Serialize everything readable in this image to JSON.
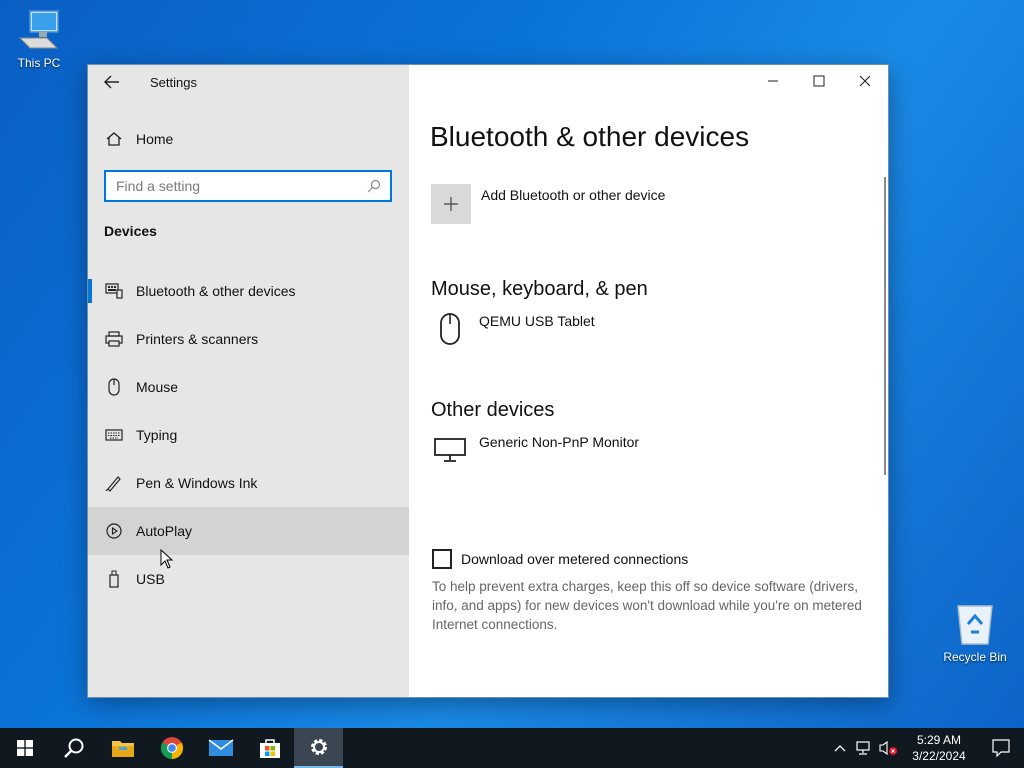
{
  "desktop": {
    "this_pc_label": "This PC",
    "recycle_bin_label": "Recycle Bin"
  },
  "window": {
    "app_title": "Settings",
    "sidebar": {
      "home_label": "Home",
      "search_placeholder": "Find a setting",
      "section_heading": "Devices",
      "items": [
        {
          "label": "Bluetooth & other devices",
          "icon": "bluetooth-devices-icon",
          "selected": true
        },
        {
          "label": "Printers & scanners",
          "icon": "printer-icon"
        },
        {
          "label": "Mouse",
          "icon": "mouse-icon"
        },
        {
          "label": "Typing",
          "icon": "keyboard-icon"
        },
        {
          "label": "Pen & Windows Ink",
          "icon": "pen-icon"
        },
        {
          "label": "AutoPlay",
          "icon": "autoplay-icon",
          "hovered": true
        },
        {
          "label": "USB",
          "icon": "usb-icon"
        }
      ]
    },
    "main": {
      "page_title": "Bluetooth & other devices",
      "add_device_label": "Add Bluetooth or other device",
      "mouse_group_title": "Mouse, keyboard, & pen",
      "mouse_devices": [
        {
          "name": "QEMU USB Tablet",
          "icon": "mouse-icon"
        }
      ],
      "other_group_title": "Other devices",
      "other_devices": [
        {
          "name": "Generic Non-PnP Monitor",
          "icon": "monitor-icon"
        }
      ],
      "metered_checkbox_label": "Download over metered connections",
      "metered_checked": false,
      "metered_description": "To help prevent extra charges, keep this off so device software (drivers, info, and apps) for new devices won't download while you're on metered Internet connections."
    }
  },
  "taskbar": {
    "time": "5:29 AM",
    "date": "3/22/2024",
    "pinned": [
      "start-icon",
      "search-icon",
      "file-explorer-icon",
      "chrome-icon",
      "mail-icon",
      "store-icon",
      "settings-icon"
    ]
  },
  "colors": {
    "accent": "#0078d7",
    "sidebar_bg": "#e6e6e6",
    "taskbar_bg": "#101820"
  }
}
